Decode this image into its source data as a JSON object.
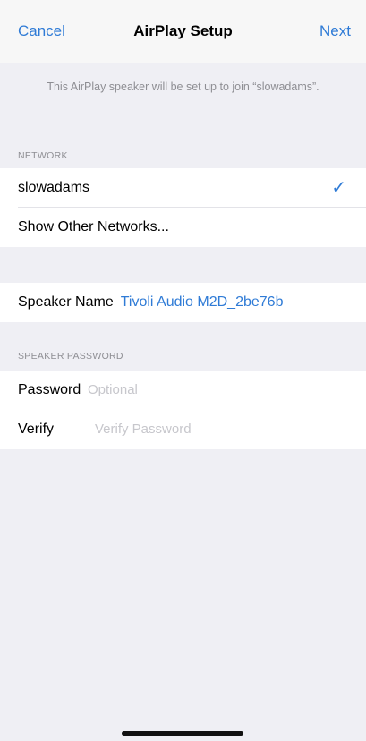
{
  "nav": {
    "cancel_label": "Cancel",
    "title": "AirPlay Setup",
    "next_label": "Next"
  },
  "info_text": "This AirPlay speaker will be set up to join “slowadams”.",
  "network": {
    "header": "NETWORK",
    "selected_network": "slowadams",
    "checkmark": "✓",
    "other_networks_label": "Show Other Networks..."
  },
  "speaker": {
    "name_label": "Speaker Name",
    "name_value": "Tivoli Audio M2D_2be76b"
  },
  "password": {
    "header": "SPEAKER PASSWORD",
    "password_label": "Password",
    "password_placeholder": "Optional",
    "verify_label": "Verify",
    "verify_placeholder": "Verify Password"
  },
  "colors": {
    "accent": "#2f7bd6",
    "background": "#efeff4",
    "secondary_text": "#8e8e93",
    "placeholder": "#c7c7cc"
  },
  "icons": {
    "checkmark": "checkmark-icon"
  }
}
